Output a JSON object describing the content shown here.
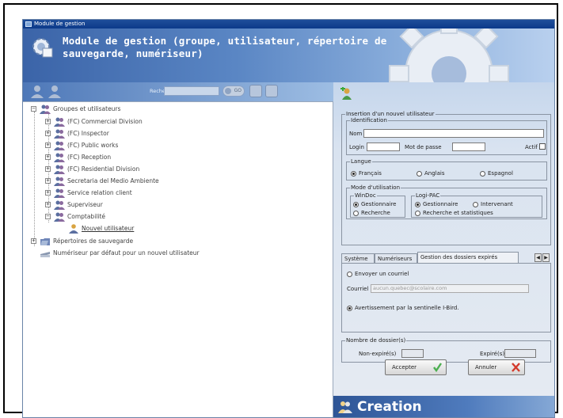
{
  "window": {
    "title": "Module de gestion"
  },
  "banner": {
    "title": "Module de gestion (groupe, utilisateur, répertoire de sauvegarde, numériseur)"
  },
  "toolbar": {
    "search_label": "Recherche",
    "search_value": "",
    "go_label": "GO"
  },
  "tree": {
    "root": "Groupes et utilisateurs",
    "groups": [
      "(FC) Commercial Division",
      "(FC) Inspector",
      "(FC) Public works",
      "(FC) Reception",
      "(FC) Residential Division",
      "Secretaria del Medio Ambiente",
      "Service relation client",
      "Superviseur",
      "Comptabilité"
    ],
    "new_user": "Nouvel utilisateur",
    "backup_dirs": "Répertoires de sauvegarde",
    "default_scanner": "Numériseur par défaut pour un nouvel utilisateur"
  },
  "form": {
    "section_title": "Insertion d'un nouvel utilisateur",
    "identification": {
      "legend": "Identification",
      "name_label": "Nom",
      "login_label": "Login",
      "password_label": "Mot de passe",
      "active_label": "Actif"
    },
    "language": {
      "legend": "Langue",
      "options": [
        "Français",
        "Anglais",
        "Espagnol"
      ],
      "selected": "Français"
    },
    "usage_mode": {
      "legend": "Mode d'utilisation",
      "windoc": {
        "legend": "WinDoc",
        "options": [
          "Gestionnaire",
          "Recherche"
        ],
        "selected": "Gestionnaire"
      },
      "logipac": {
        "legend": "Logi-PAC",
        "options": [
          "Gestionnaire",
          "Intervenant",
          "Recherche et statistiques"
        ],
        "selected": "Gestionnaire"
      }
    },
    "tabs": [
      "Système",
      "Numériseurs",
      "Gestion des dossiers expirés"
    ],
    "tab_nav": {
      "prev": "◀",
      "next": "▶"
    },
    "expired": {
      "send_email_label": "Envoyer un courriel",
      "email_label": "Courriel",
      "email_value": "aucun.quebec@scolaire.com",
      "sentinel_label": "Avertissement par la sentinelle I-Bird."
    },
    "folder_count": {
      "legend": "Nombre de dossier(s)",
      "unexpired_label": "Non-expiré(s)",
      "expired_label": "Expiré(s)"
    },
    "buttons": {
      "accept": "Accepter",
      "cancel": "Annuler"
    }
  },
  "footer": {
    "label": "Creation"
  },
  "colors": {
    "accent": "#3b64a8",
    "banner_light": "#b9d0ee",
    "accept_check": "#4caf50",
    "cancel_x": "#d33a2c"
  }
}
